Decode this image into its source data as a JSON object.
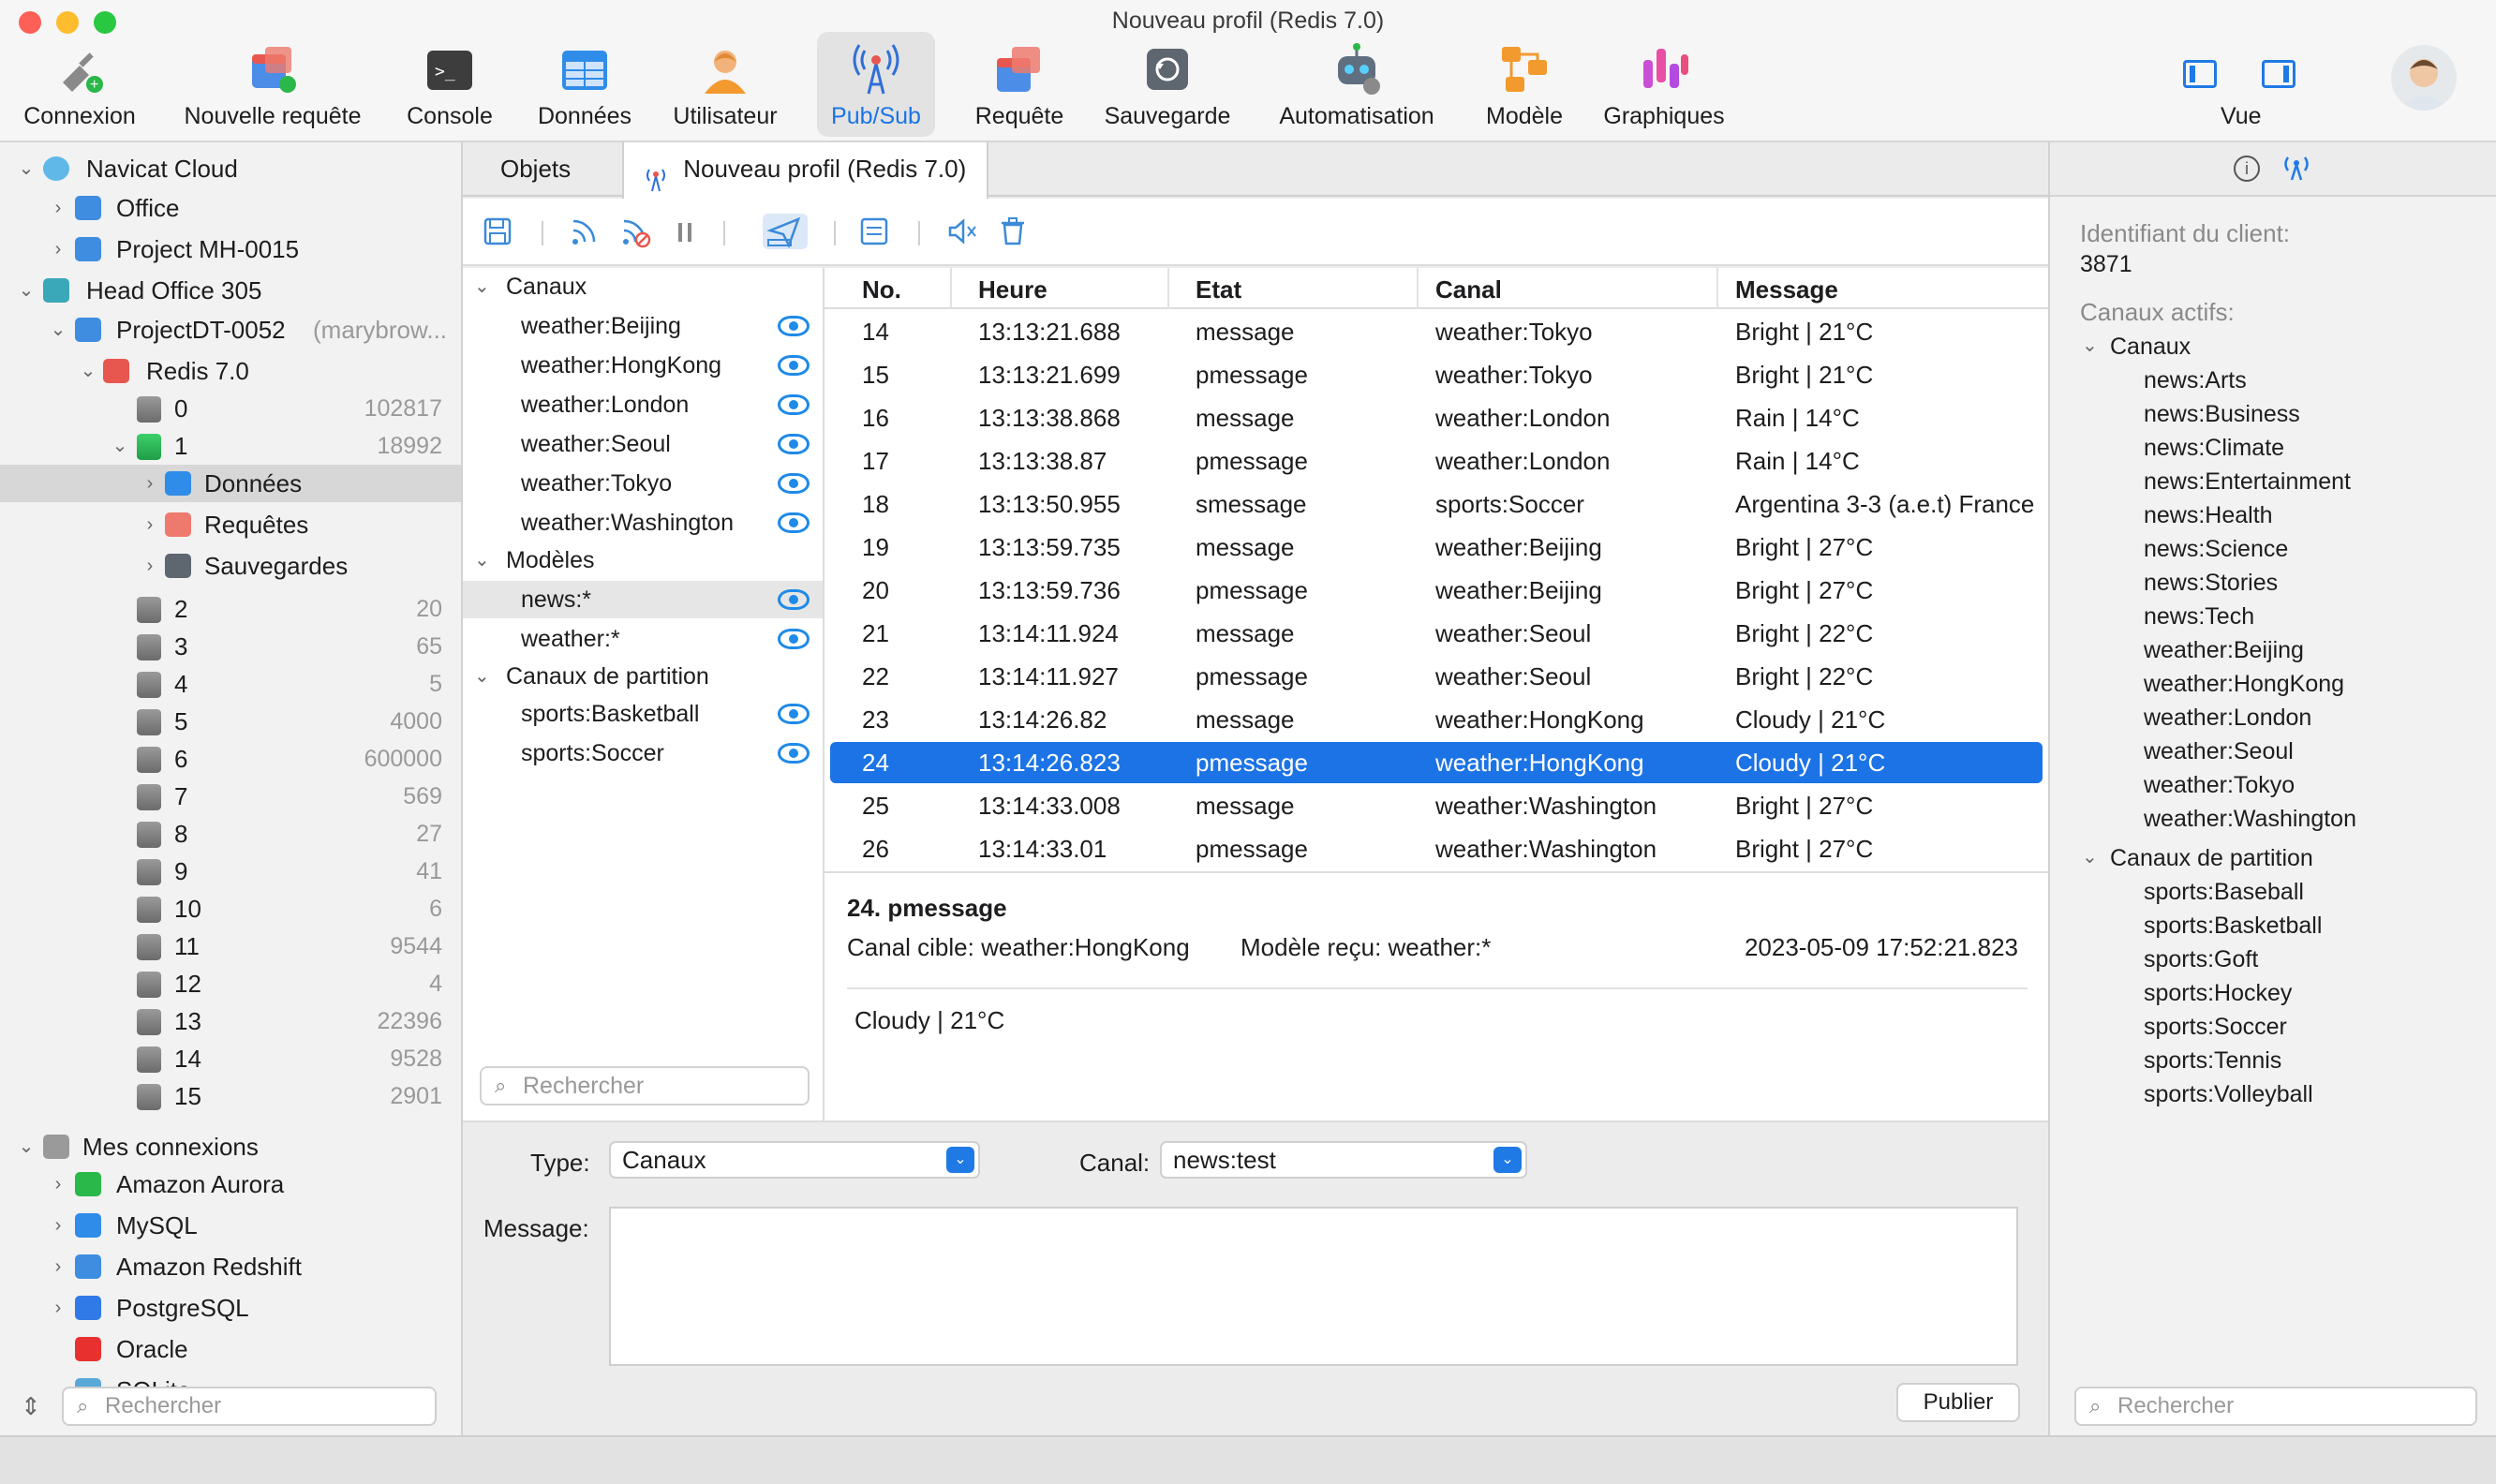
{
  "window": {
    "title": "Nouveau profil (Redis 7.0)"
  },
  "toolbar": {
    "connexion": "Connexion",
    "nouvelle_requete": "Nouvelle requête",
    "console": "Console",
    "donnees": "Données",
    "utilisateur": "Utilisateur",
    "pubsub": "Pub/Sub",
    "requete": "Requête",
    "sauvegarde": "Sauvegarde",
    "automatisation": "Automatisation",
    "modele": "Modèle",
    "graphiques": "Graphiques",
    "vue": "Vue"
  },
  "sidebar": {
    "navicat_cloud": "Navicat Cloud",
    "office": "Office",
    "project_mh": "Project MH-0015",
    "head_office": "Head Office 305",
    "project_dt": "ProjectDT-0052",
    "project_dt_owner": "(marybrow...",
    "redis": "Redis 7.0",
    "dbs": [
      {
        "name": "0",
        "count": "102817"
      },
      {
        "name": "1",
        "count": "18992"
      }
    ],
    "donnees": "Données",
    "requetes": "Requêtes",
    "sauvegardes": "Sauvegardes",
    "dbs2": [
      {
        "name": "2",
        "count": "20"
      },
      {
        "name": "3",
        "count": "65"
      },
      {
        "name": "4",
        "count": "5"
      },
      {
        "name": "5",
        "count": "4000"
      },
      {
        "name": "6",
        "count": "600000"
      },
      {
        "name": "7",
        "count": "569"
      },
      {
        "name": "8",
        "count": "27"
      },
      {
        "name": "9",
        "count": "41"
      },
      {
        "name": "10",
        "count": "6"
      },
      {
        "name": "11",
        "count": "9544"
      },
      {
        "name": "12",
        "count": "4"
      },
      {
        "name": "13",
        "count": "22396"
      },
      {
        "name": "14",
        "count": "9528"
      },
      {
        "name": "15",
        "count": "2901"
      }
    ],
    "mes_connexions": "Mes connexions",
    "connections": [
      "Amazon Aurora",
      "MySQL",
      "Amazon Redshift",
      "PostgreSQL",
      "Oracle",
      "SQLite"
    ],
    "search_placeholder": "Rechercher"
  },
  "tabs": {
    "objets": "Objets",
    "profil": "Nouveau profil (Redis 7.0)"
  },
  "channels": {
    "canaux_header": "Canaux",
    "canaux": [
      "weather:Beijing",
      "weather:HongKong",
      "weather:London",
      "weather:Seoul",
      "weather:Tokyo",
      "weather:Washington"
    ],
    "modeles_header": "Modèles",
    "modeles": [
      "news:*",
      "weather:*"
    ],
    "partition_header": "Canaux de partition",
    "partition": [
      "sports:Basketball",
      "sports:Soccer"
    ],
    "search_placeholder": "Rechercher"
  },
  "grid": {
    "headers": [
      "No.",
      "Heure",
      "Etat",
      "Canal",
      "Message"
    ],
    "rows": [
      [
        "14",
        "13:13:21.688",
        "message",
        "weather:Tokyo",
        "Bright | 21°C"
      ],
      [
        "15",
        "13:13:21.699",
        "pmessage",
        "weather:Tokyo",
        "Bright | 21°C"
      ],
      [
        "16",
        "13:13:38.868",
        "message",
        "weather:London",
        "Rain | 14°C"
      ],
      [
        "17",
        "13:13:38.87",
        "pmessage",
        "weather:London",
        "Rain | 14°C"
      ],
      [
        "18",
        "13:13:50.955",
        "smessage",
        "sports:Soccer",
        "Argentina 3-3 (a.e.t) France"
      ],
      [
        "19",
        "13:13:59.735",
        "message",
        "weather:Beijing",
        "Bright | 27°C"
      ],
      [
        "20",
        "13:13:59.736",
        "pmessage",
        "weather:Beijing",
        "Bright | 27°C"
      ],
      [
        "21",
        "13:14:11.924",
        "message",
        "weather:Seoul",
        "Bright | 22°C"
      ],
      [
        "22",
        "13:14:11.927",
        "pmessage",
        "weather:Seoul",
        "Bright | 22°C"
      ],
      [
        "23",
        "13:14:26.82",
        "message",
        "weather:HongKong",
        "Cloudy | 21°C"
      ],
      [
        "24",
        "13:14:26.823",
        "pmessage",
        "weather:HongKong",
        "Cloudy | 21°C"
      ],
      [
        "25",
        "13:14:33.008",
        "message",
        "weather:Washington",
        "Bright | 27°C"
      ],
      [
        "26",
        "13:14:33.01",
        "pmessage",
        "weather:Washington",
        "Bright | 27°C"
      ]
    ]
  },
  "detail": {
    "title": "24. pmessage",
    "target": "Canal cible: weather:HongKong",
    "pattern": "Modèle reçu: weather:*",
    "timestamp": "2023-05-09 17:52:21.823",
    "body": "Cloudy | 21°C"
  },
  "form": {
    "type_label": "Type:",
    "type_value": "Canaux",
    "canal_label": "Canal:",
    "canal_value": "news:test",
    "message_label": "Message:",
    "publish": "Publier"
  },
  "right": {
    "client_id_label": "Identifiant du client:",
    "client_id": "3871",
    "active_label": "Canaux actifs:",
    "canaux_header": "Canaux",
    "canaux": [
      "news:Arts",
      "news:Business",
      "news:Climate",
      "news:Entertainment",
      "news:Health",
      "news:Science",
      "news:Stories",
      "news:Tech",
      "weather:Beijing",
      "weather:HongKong",
      "weather:London",
      "weather:Seoul",
      "weather:Tokyo",
      "weather:Washington"
    ],
    "partition_header": "Canaux de partition",
    "partition": [
      "sports:Baseball",
      "sports:Basketball",
      "sports:Goft",
      "sports:Hockey",
      "sports:Soccer",
      "sports:Tennis",
      "sports:Volleyball"
    ],
    "search_placeholder": "Rechercher"
  },
  "colors": {
    "accent": "#1c73e6",
    "selection": "#d7d7d7"
  }
}
